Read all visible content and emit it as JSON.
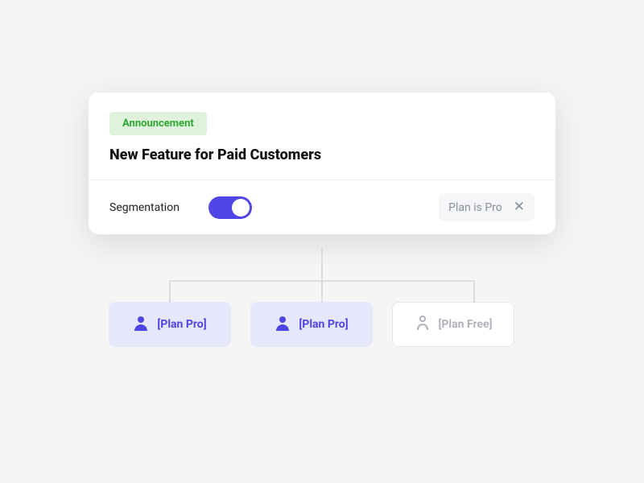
{
  "card": {
    "badge": "Announcement",
    "title": "New Feature for Paid Customers",
    "segmentation_label": "Segmentation",
    "segmentation_on": true,
    "chip": {
      "label": "Plan is Pro",
      "close": "✕"
    }
  },
  "nodes": [
    {
      "label": "[Plan Pro]",
      "state": "active"
    },
    {
      "label": "[Plan Pro]",
      "state": "active"
    },
    {
      "label": "[Plan Free]",
      "state": "inactive"
    }
  ],
  "colors": {
    "accent": "#4f46e5",
    "badge_bg": "#dff2de",
    "badge_fg": "#2fa82f"
  }
}
